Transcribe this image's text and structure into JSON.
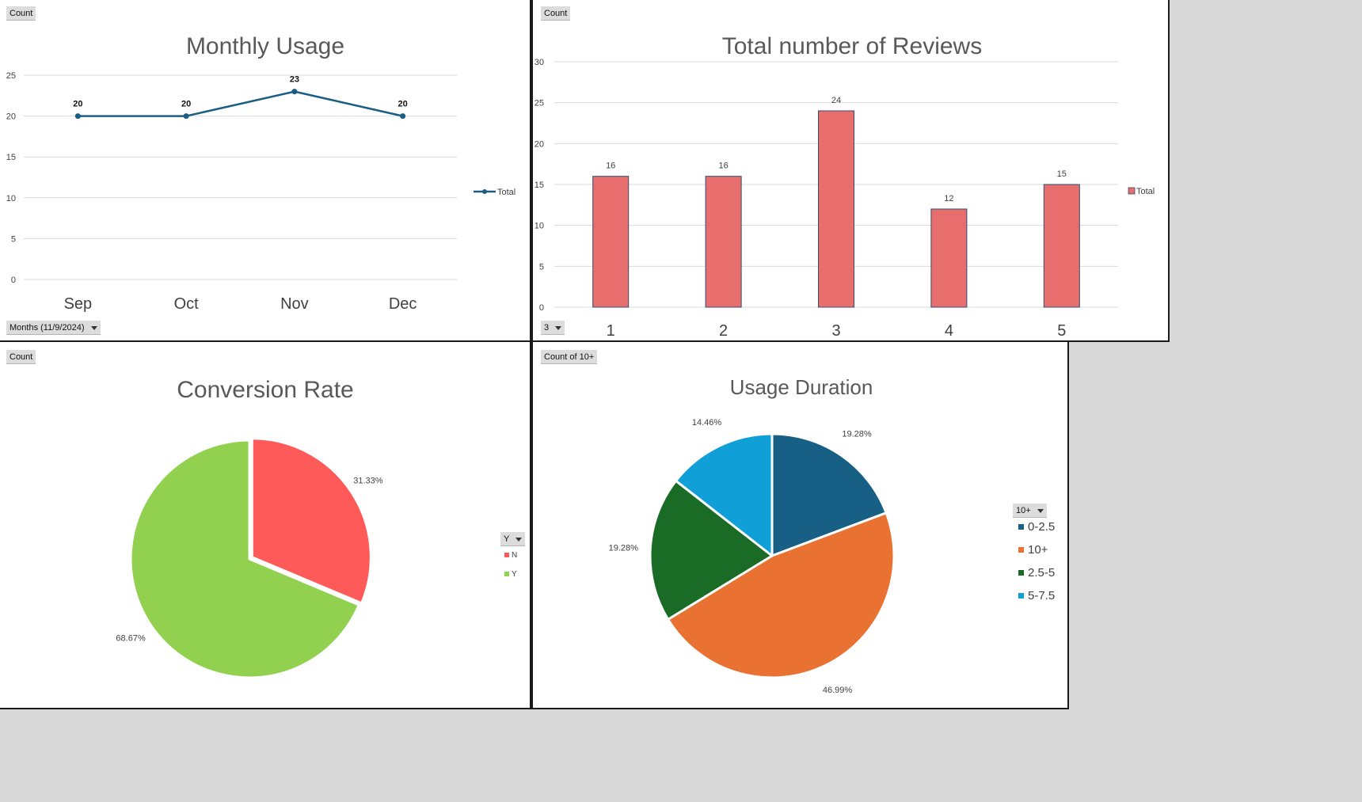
{
  "panels": {
    "monthly": {
      "value_button": "Count",
      "axis_button": "Months (11/9/2024)"
    },
    "reviews": {
      "value_button": "Count",
      "filter_button": "3"
    },
    "conversion": {
      "value_button": "Count",
      "legend_button": "Y"
    },
    "duration": {
      "value_button": "Count of 10+",
      "legend_button": "10+"
    }
  },
  "colors": {
    "line": "#1b5e83",
    "bar": "#e86d6d",
    "conversion_N": "#ff5a5a",
    "conversion_Y": "#92d050",
    "duration_0_2_5": "#175f84",
    "duration_10_plus": "#e97132",
    "duration_2_5_5": "#1a6b26",
    "duration_5_7_5": "#119fd8"
  },
  "chart_data": [
    {
      "type": "line",
      "title": "Monthly Usage",
      "categories": [
        "Sep",
        "Oct",
        "Nov",
        "Dec"
      ],
      "series": [
        {
          "name": "Total",
          "values": [
            20,
            20,
            23,
            20
          ]
        }
      ],
      "data_labels": [
        "20",
        "20",
        "23",
        "20"
      ],
      "ylim": [
        0,
        25
      ],
      "yticks": [
        "0",
        "5",
        "10",
        "15",
        "20",
        "25"
      ],
      "grid": true,
      "legend": "right"
    },
    {
      "type": "bar",
      "title": "Total number of Reviews",
      "categories": [
        "1",
        "2",
        "3",
        "4",
        "5"
      ],
      "series": [
        {
          "name": "Total",
          "values": [
            16,
            16,
            24,
            12,
            15
          ]
        }
      ],
      "data_labels": [
        "16",
        "16",
        "24",
        "12",
        "15"
      ],
      "ylim": [
        0,
        30
      ],
      "yticks": [
        "0",
        "5",
        "10",
        "15",
        "20",
        "25",
        "30"
      ],
      "grid": true,
      "legend": "right"
    },
    {
      "type": "pie",
      "title": "Conversion Rate",
      "labels": [
        "N",
        "Y"
      ],
      "values": [
        31.33,
        68.67
      ],
      "data_labels": [
        "31.33%",
        "68.67%"
      ],
      "legend": "right"
    },
    {
      "type": "pie",
      "title": "Usage Duration",
      "labels": [
        "0-2.5",
        "10+",
        "2.5-5",
        "5-7.5"
      ],
      "values": [
        19.28,
        46.99,
        19.28,
        14.46
      ],
      "data_labels": [
        "19.28%",
        "46.99%",
        "19.28%",
        "14.46%"
      ],
      "legend": "right"
    }
  ]
}
